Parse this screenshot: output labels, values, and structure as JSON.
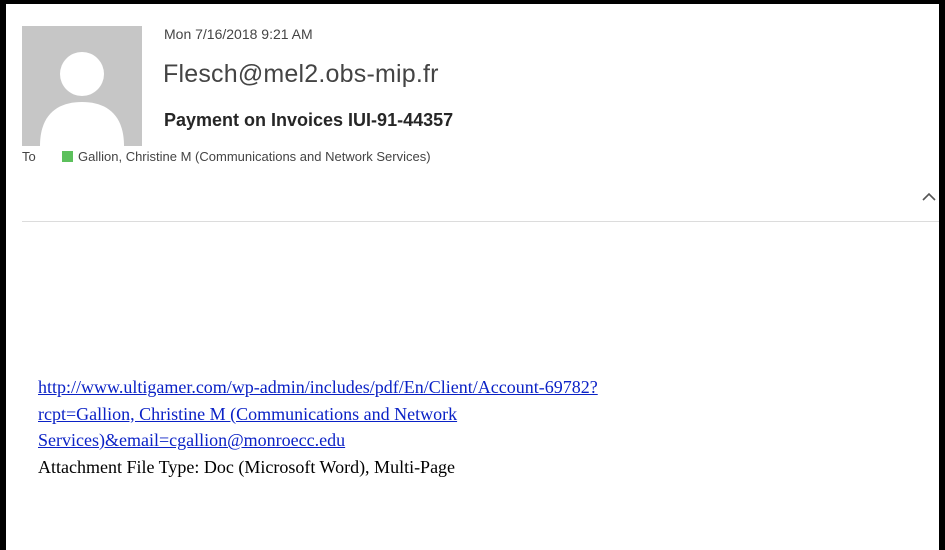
{
  "email": {
    "date": "Mon 7/16/2018 9:21 AM",
    "sender": "Flesch@mel2.obs-mip.fr",
    "subject": "Payment on Invoices IUI-91-44357",
    "to_label": "To",
    "recipient": "Gallion, Christine M (Communications and Network Services)"
  },
  "body": {
    "link_lines": [
      "http://www.ultigamer.com/wp-admin/includes/pdf/En/Client/Account-69782?",
      "rcpt=Gallion, Christine M (Communications and Network",
      "Services)&email=cgallion@monroecc.edu"
    ],
    "attachment_text": "Attachment File Type: Doc (Microsoft Word), Multi-Page"
  },
  "colors": {
    "link": "#0b22c6",
    "presence": "#5cc05c",
    "avatar_bg": "#c6c6c6"
  }
}
